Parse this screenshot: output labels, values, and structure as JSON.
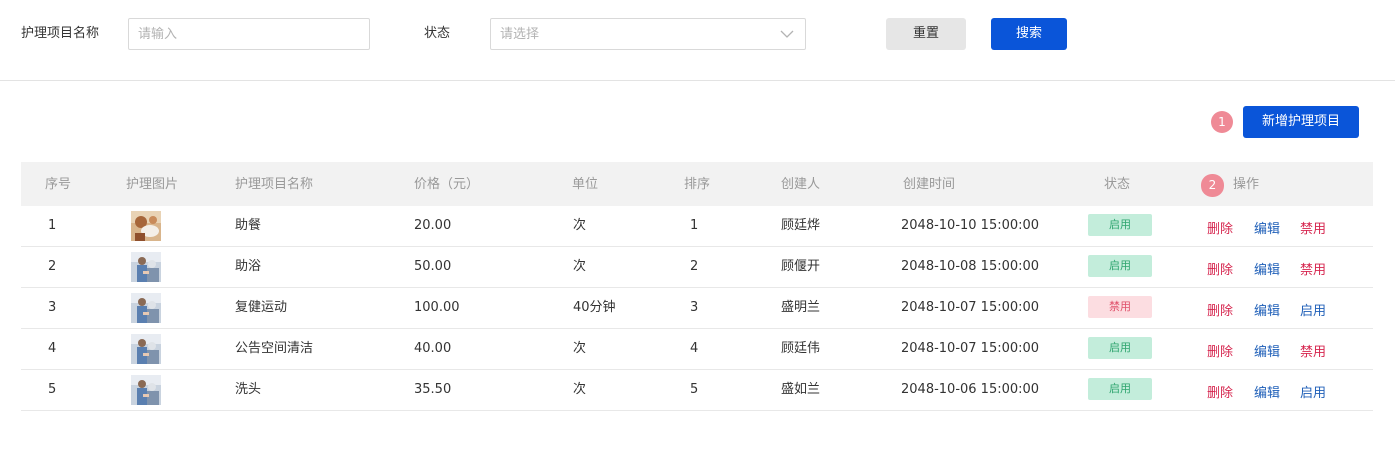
{
  "filters": {
    "name_label": "护理项目名称",
    "name_placeholder": "请输入",
    "status_label": "状态",
    "status_placeholder": "请选择",
    "reset_label": "重置",
    "search_label": "搜索"
  },
  "toolbar": {
    "badge_1": "1",
    "add_label": "新增护理项目"
  },
  "table": {
    "headers": [
      "序号",
      "护理图片",
      "护理项目名称",
      "价格（元）",
      "单位",
      "排序",
      "创建人",
      "创建时间",
      "状态",
      "操作"
    ],
    "actions_badge": "2",
    "rows": [
      {
        "no": "1",
        "name": "助餐",
        "price": "20.00",
        "unit": "次",
        "order": "1",
        "creator": "顾廷烨",
        "created": "2048-10-10 15:00:00",
        "status": "启用",
        "delete": "删除",
        "edit": "编辑",
        "toggle": "禁用"
      },
      {
        "no": "2",
        "name": "助浴",
        "price": "50.00",
        "unit": "次",
        "order": "2",
        "creator": "顾偃开",
        "created": "2048-10-08 15:00:00",
        "status": "启用",
        "delete": "删除",
        "edit": "编辑",
        "toggle": "禁用"
      },
      {
        "no": "3",
        "name": "复健运动",
        "price": "100.00",
        "unit": "40分钟",
        "order": "3",
        "creator": "盛明兰",
        "created": "2048-10-07 15:00:00",
        "status": "禁用",
        "delete": "删除",
        "edit": "编辑",
        "toggle": "启用"
      },
      {
        "no": "4",
        "name": "公告空间清洁",
        "price": "40.00",
        "unit": "次",
        "order": "4",
        "creator": "顾廷伟",
        "created": "2048-10-07 15:00:00",
        "status": "启用",
        "delete": "删除",
        "edit": "编辑",
        "toggle": "禁用"
      },
      {
        "no": "5",
        "name": "洗头",
        "price": "35.50",
        "unit": "次",
        "order": "5",
        "creator": "盛如兰",
        "created": "2048-10-06 15:00:00",
        "status": "启用",
        "delete": "删除",
        "edit": "编辑",
        "toggle": "启用"
      }
    ]
  },
  "colors": {
    "primary": "#0a55d9",
    "enabled_bg": "#c3eddb",
    "enabled_text": "#2fa56f",
    "disabled_bg": "#fcdde1",
    "disabled_text": "#e0516b",
    "delete_text": "#d6254e",
    "edit_text": "#1f5fb8",
    "badge": "#ef8a96"
  }
}
